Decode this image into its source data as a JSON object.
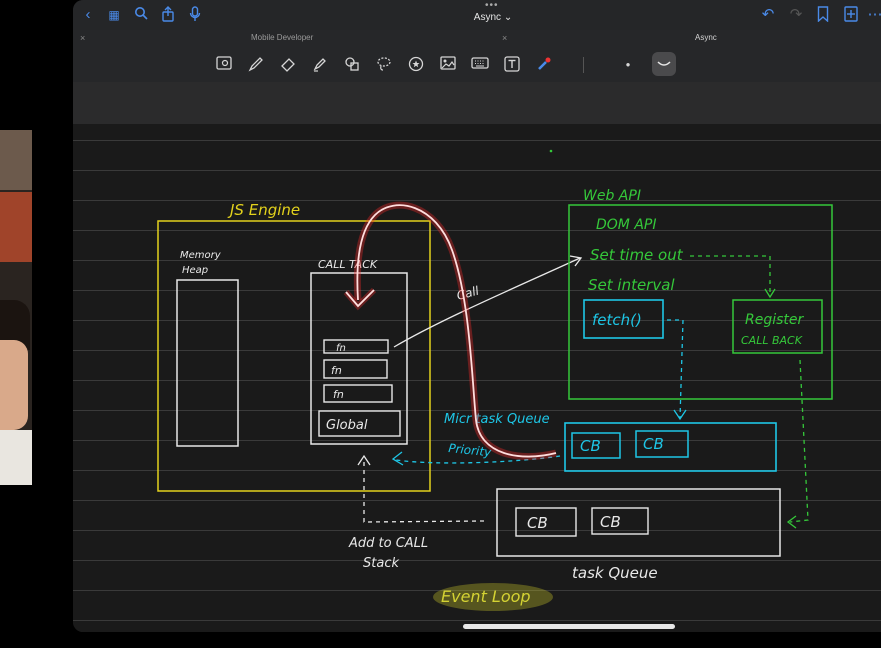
{
  "app": {
    "title": "Async",
    "title_suffix": "⌄",
    "tabs": [
      {
        "label": "Mobile Developer"
      },
      {
        "label": "Async"
      }
    ],
    "tab_close_glyph": "×",
    "more_glyph": "•••"
  },
  "toolbar_icons": [
    "scan-icon",
    "pen-icon",
    "eraser-icon",
    "highlighter-icon",
    "shapes-icon",
    "lasso-icon",
    "favorite-icon",
    "image-icon",
    "keyboard-icon",
    "text-icon",
    "laser-icon"
  ],
  "colors": {
    "accent_blue": "#4a8ae8",
    "js_engine": "#e3d21c",
    "web_api": "#35c83a",
    "microtask": "#1ec6e6",
    "annotation_red": "#ff2a2a",
    "chalk_white": "#e8e8e8",
    "highlight_yellow": "#c9c72a"
  },
  "whiteboard": {
    "js_engine_label": "JS Engine",
    "memory_heap_label_1": "Memory",
    "memory_heap_label_2": "Heap",
    "call_stack_label": "CALL  TACK",
    "stack_frames": [
      "fn",
      "fn",
      "fn",
      "Global"
    ],
    "call_label": "Call",
    "web_api_label": "Web API",
    "web_api_items": [
      "DOM API",
      "Set time out",
      "Set interval"
    ],
    "fetch_label": "fetch()",
    "register_label_1": "Register",
    "register_label_2": "CALL BACK",
    "microtask_label": "Micr task Queue",
    "priority_label": "Priority",
    "microtask_items": [
      "CB",
      "CB"
    ],
    "task_queue_items": [
      "CB",
      "CB"
    ],
    "task_queue_label": "task Queue",
    "add_to_stack_1": "Add to CALL",
    "add_to_stack_2": "Stack",
    "event_loop_label": "Event Loop"
  }
}
